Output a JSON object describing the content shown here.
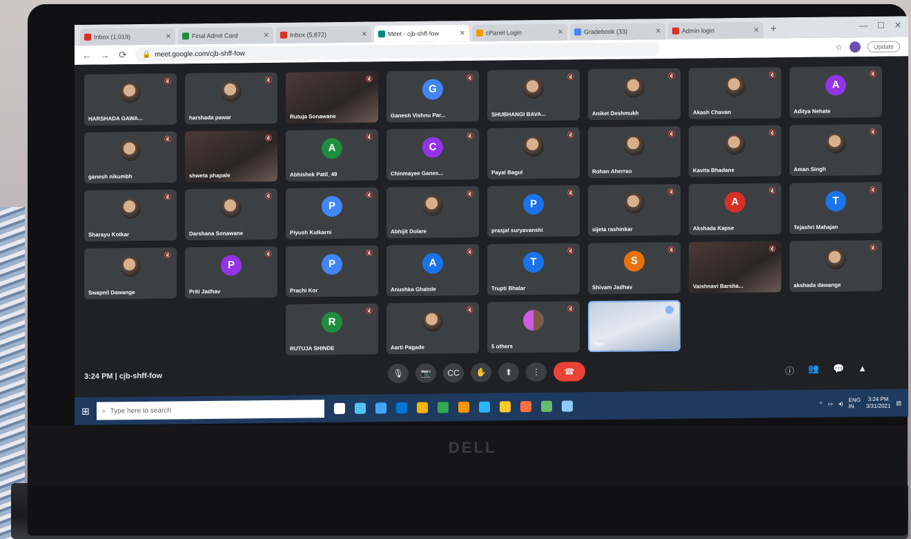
{
  "browser": {
    "tabs": [
      {
        "title": "Inbox (1,019)",
        "active": false,
        "favicon_color": "#d93025"
      },
      {
        "title": "Final Admit Card",
        "active": false,
        "favicon_color": "#1e8e3e"
      },
      {
        "title": "Inbox (5,872)",
        "active": false,
        "favicon_color": "#d93025"
      },
      {
        "title": "Meet - cjb-shff-fow",
        "active": true,
        "favicon_color": "#00897b"
      },
      {
        "title": "cPanel Login",
        "active": false,
        "favicon_color": "#f29900"
      },
      {
        "title": "Gradebook (33)",
        "active": false,
        "favicon_color": "#4285f4"
      },
      {
        "title": "Admin login",
        "active": false,
        "favicon_color": "#d93025"
      }
    ],
    "url": "meet.google.com/cjb-shff-fow",
    "update_label": "Update"
  },
  "participants": [
    {
      "name": "HARSHADA GAWA...",
      "kind": "photo"
    },
    {
      "name": "harshada pawar",
      "kind": "photo"
    },
    {
      "name": "Rutuja Sonawane",
      "kind": "video"
    },
    {
      "name": "Ganesh Vishnu Par...",
      "kind": "initial",
      "initial": "G",
      "color": "#4285f4"
    },
    {
      "name": "SHUBHANGI BAVA...",
      "kind": "photo"
    },
    {
      "name": "Aniket Deshmukh",
      "kind": "photo"
    },
    {
      "name": "Akash Chavan",
      "kind": "photo"
    },
    {
      "name": "Aditya Nehate",
      "kind": "initial",
      "initial": "A",
      "color": "#9334e6"
    },
    {
      "name": "ganesh nikumbh",
      "kind": "photo"
    },
    {
      "name": "shweta phapale",
      "kind": "video"
    },
    {
      "name": "Abhishek Patil_49",
      "kind": "initial",
      "initial": "A",
      "color": "#1e8e3e"
    },
    {
      "name": "Chinmayee Ganes...",
      "kind": "initial",
      "initial": "C",
      "color": "#9334e6"
    },
    {
      "name": "Payal Bagul",
      "kind": "photo"
    },
    {
      "name": "Rohan Aherrao",
      "kind": "photo"
    },
    {
      "name": "Kavita Bhadane",
      "kind": "photo"
    },
    {
      "name": "Aman Singh",
      "kind": "photo"
    },
    {
      "name": "Sharayu Kotkar",
      "kind": "photo"
    },
    {
      "name": "Darshana Sonawane",
      "kind": "photo"
    },
    {
      "name": "Piyush Kulkarni",
      "kind": "initial",
      "initial": "P",
      "color": "#4285f4"
    },
    {
      "name": "Abhijit Dolare",
      "kind": "photo"
    },
    {
      "name": "prasjal suryavanshi",
      "kind": "initial",
      "initial": "P",
      "color": "#1a73e8"
    },
    {
      "name": "sijeta rashinkar",
      "kind": "photo"
    },
    {
      "name": "Akshada Kapse",
      "kind": "initial",
      "initial": "A",
      "color": "#d93025"
    },
    {
      "name": "Tejashri Mahajan",
      "kind": "initial",
      "initial": "T",
      "color": "#1a73e8"
    },
    {
      "name": "Swapnil Dawange",
      "kind": "photo"
    },
    {
      "name": "Priti Jadhav",
      "kind": "initial",
      "initial": "P",
      "color": "#9334e6"
    },
    {
      "name": "Prachi Kor",
      "kind": "initial",
      "initial": "P",
      "color": "#4285f4"
    },
    {
      "name": "Anushka Ghatole",
      "kind": "initial",
      "initial": "A",
      "color": "#1a73e8"
    },
    {
      "name": "Trupti Bhalar",
      "kind": "initial",
      "initial": "T",
      "color": "#1a73e8"
    },
    {
      "name": "Shivam Jadhav",
      "kind": "initial",
      "initial": "S",
      "color": "#e8710a"
    },
    {
      "name": "Vaishnavi Barsha...",
      "kind": "video"
    },
    {
      "name": "akshada dawange",
      "kind": "photo"
    },
    {
      "name": "",
      "kind": "empty"
    },
    {
      "name": "",
      "kind": "empty"
    },
    {
      "name": "RUTUJA SHINDE",
      "kind": "initial",
      "initial": "R",
      "color": "#1e8e3e"
    },
    {
      "name": "Aarti Pagade",
      "kind": "photo"
    },
    {
      "name": "5 others",
      "kind": "others"
    },
    {
      "name": "You",
      "kind": "self"
    },
    {
      "name": "",
      "kind": "empty"
    },
    {
      "name": "",
      "kind": "empty"
    }
  ],
  "meeting": {
    "time": "3:24 PM",
    "separator": "|",
    "code": "cjb-shff-fow"
  },
  "controls": [
    {
      "name": "mic-button",
      "icon": "🎙"
    },
    {
      "name": "camera-button",
      "icon": "📷"
    },
    {
      "name": "captions-button",
      "icon": "CC"
    },
    {
      "name": "raise-hand-button",
      "icon": "✋"
    },
    {
      "name": "present-button",
      "icon": "⬆"
    },
    {
      "name": "more-options-button",
      "icon": "⋮"
    },
    {
      "name": "end-call-button",
      "icon": "☎",
      "end": true
    }
  ],
  "right_controls": [
    {
      "name": "meeting-details-icon",
      "icon": "ⓘ"
    },
    {
      "name": "people-icon",
      "icon": "👥"
    },
    {
      "name": "chat-icon",
      "icon": "💬"
    },
    {
      "name": "activities-icon",
      "icon": "▲"
    }
  ],
  "taskbar": {
    "search_placeholder": "Type here to search",
    "lang": "ENG\nIN",
    "clock_time": "3:24 PM",
    "clock_date": "3/31/2021",
    "icons": [
      "#ffffff",
      "#4fc3f7",
      "#42a5f5",
      "#0078d4",
      "#f4b400",
      "#34a853",
      "#ff9800",
      "#29b6f6",
      "#ffca28",
      "#ff7043",
      "#66bb6a",
      "#90caf9"
    ]
  },
  "brand": "DELL"
}
